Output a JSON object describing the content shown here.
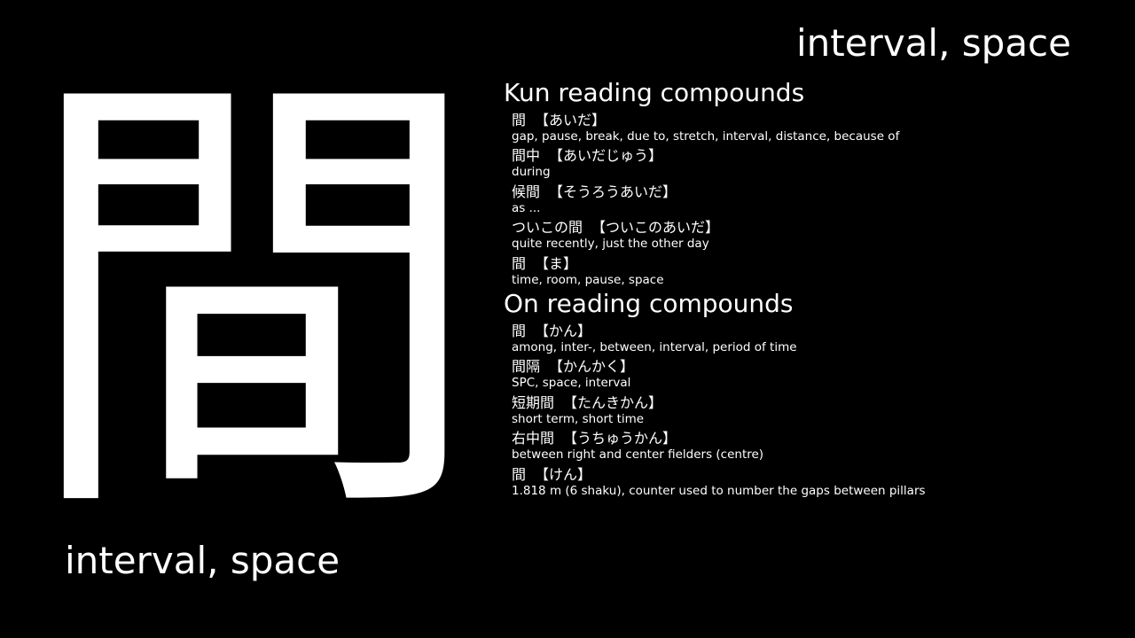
{
  "meaning_top": "interval, space",
  "kanji": "間",
  "meaning_bottom": "interval, space",
  "kun": {
    "heading": "Kun reading compounds",
    "entries": [
      {
        "word": "間",
        "reading": "【あいだ】",
        "meaning": "gap, pause, break, due to, stretch, interval, distance, because of"
      },
      {
        "word": "間中",
        "reading": "【あいだじゅう】",
        "meaning": "during"
      },
      {
        "word": "候間",
        "reading": "【そうろうあいだ】",
        "meaning": "as ..."
      },
      {
        "word": "ついこの間",
        "reading": "【ついこのあいだ】",
        "meaning": "quite recently, just the other day"
      },
      {
        "word": "間",
        "reading": "【ま】",
        "meaning": "time, room, pause, space"
      }
    ]
  },
  "on": {
    "heading": "On reading compounds",
    "entries": [
      {
        "word": "間",
        "reading": "【かん】",
        "meaning": "among, inter-, between, interval, period of time"
      },
      {
        "word": "間隔",
        "reading": "【かんかく】",
        "meaning": "SPC, space, interval"
      },
      {
        "word": "短期間",
        "reading": "【たんきかん】",
        "meaning": "short term, short time"
      },
      {
        "word": "右中間",
        "reading": "【うちゅうかん】",
        "meaning": "between right and center fielders (centre)"
      },
      {
        "word": "間",
        "reading": "【けん】",
        "meaning": "1.818 m (6 shaku), counter used to number the gaps between pillars"
      }
    ]
  }
}
